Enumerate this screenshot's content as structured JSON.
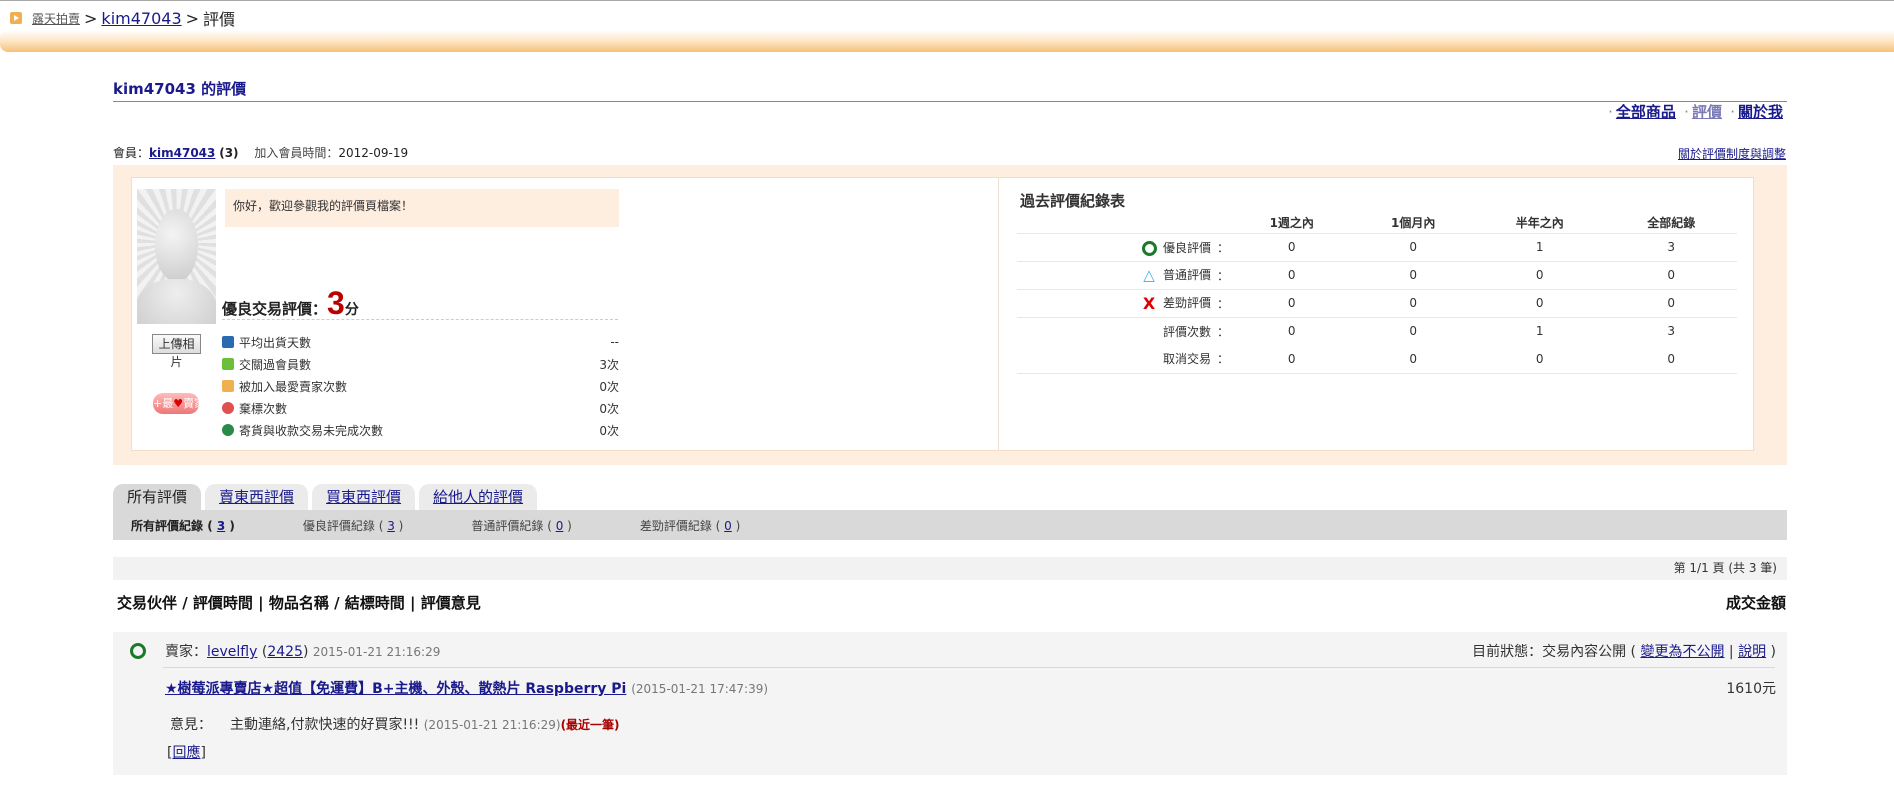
{
  "breadcrumb": {
    "site": "露天拍賣",
    "sep1": ">",
    "user": "kim47043",
    "sep2": ">",
    "current": "評價"
  },
  "page_title": "kim47043 的評價",
  "top_links": {
    "all_items": "全部商品",
    "ratings": "評價",
    "about": "關於我",
    "sep": "·"
  },
  "member": {
    "label": "會員：",
    "name": "kim47043",
    "score": "(3)",
    "join_label": "加入會員時間：",
    "join_date": "2012-09-19"
  },
  "rule_link": "關於評價制度與調整",
  "profile": {
    "upload_button": "上傳相片",
    "fav_button": {
      "plus": "+最",
      "heart": "♥",
      "text": "賣家"
    },
    "welcome": "你好，歡迎參觀我的評價頁檔案！",
    "score_label": "優良交易評價：",
    "score_value": "3",
    "score_unit": "分",
    "stats": [
      {
        "label": "平均出貨天數",
        "value": "--",
        "icon": "truck-icon",
        "color": "#2a6ab0"
      },
      {
        "label": "交關過會員數",
        "value": "3次",
        "icon": "person-green-icon",
        "color": "#6cbf3a"
      },
      {
        "label": "被加入最愛賣家次數",
        "value": "0次",
        "icon": "person-orange-icon",
        "color": "#f0b050"
      },
      {
        "label": "棄標次數",
        "value": "0次",
        "icon": "sad-face-red-icon",
        "color": "#e05050"
      },
      {
        "label": "寄貨與收款交易未完成次數",
        "value": "0次",
        "icon": "sad-face-green-icon",
        "color": "#2a8a4a"
      }
    ]
  },
  "history": {
    "title": "過去評價紀錄表",
    "columns": [
      "1週之內",
      "1個月內",
      "半年之內",
      "全部紀錄"
    ],
    "colon": "：",
    "rows": [
      {
        "label": "優良評價",
        "mark": "○",
        "values": [
          "0",
          "0",
          "1",
          "3"
        ]
      },
      {
        "label": "普通評價",
        "mark": "△",
        "values": [
          "0",
          "0",
          "0",
          "0"
        ]
      },
      {
        "label": "差勁評價",
        "mark": "X",
        "values": [
          "0",
          "0",
          "0",
          "0"
        ]
      },
      {
        "label": "評價次數",
        "mark": "",
        "values": [
          "0",
          "0",
          "1",
          "3"
        ]
      },
      {
        "label": "取消交易",
        "mark": "",
        "values": [
          "0",
          "0",
          "0",
          "0"
        ]
      }
    ]
  },
  "tabs": [
    "所有評價",
    "賣東西評價",
    "買東西評價",
    "給他人的評價"
  ],
  "filters": [
    {
      "label": "所有評價紀錄",
      "open": " ( ",
      "count": "3",
      "close": " )"
    },
    {
      "label": "優良評價紀錄",
      "open": " ( ",
      "count": "3",
      "close": " )"
    },
    {
      "label": "普通評價紀錄",
      "open": " ( ",
      "count": "0",
      "close": " )"
    },
    {
      "label": "差勁評價紀錄",
      "open": " ( ",
      "count": "0",
      "close": " )"
    }
  ],
  "pager": "第 1/1 頁 (共 3 筆)",
  "column_header": "交易伙伴 / 評價時間 | 物品名稱 / 結標時間 | 評價意見",
  "amount_header": "成交金額",
  "record": {
    "role": "賣家：",
    "partner": "levelfly",
    "partner_score": "2425",
    "rated_time": "2015-01-21 21:16:29",
    "status_label": "目前狀態：交易內容公開 (",
    "status_change": "變更為不公開",
    "status_sep": " | ",
    "status_help": "說明",
    "status_close": " )",
    "item": "★樹莓派專賣店★超值【免運費】B+主機、外殼、散熱片 Raspberry Pi",
    "end_time": "(2015-01-21 17:47:39)",
    "amount": "1610元",
    "comment_label": "意見：",
    "comment": "主動連絡,付款快速的好買家!!!",
    "comment_time": "(2015-01-21 21:16:29)",
    "recent": "(最近一筆)",
    "reply": "回應"
  }
}
